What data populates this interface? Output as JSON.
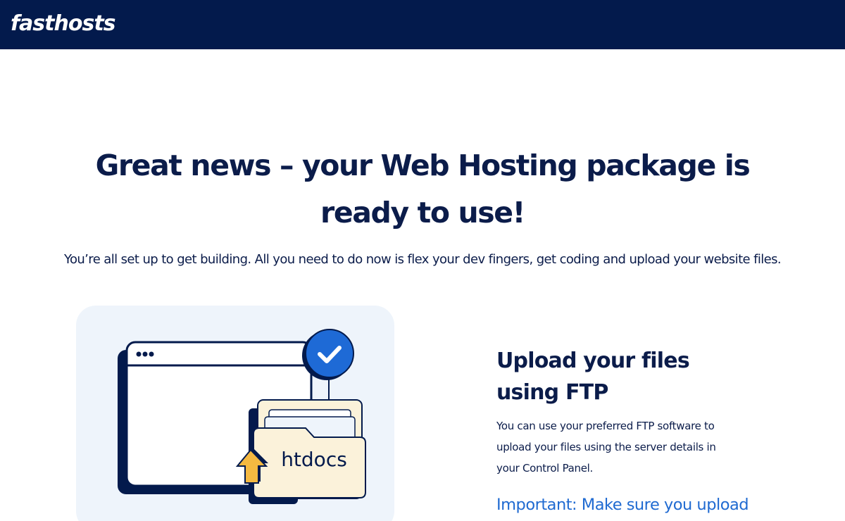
{
  "header": {
    "logo_text": "fasthosts",
    "background": "#031a4c"
  },
  "hero": {
    "title": "Great news – your Web Hosting package is ready to use!",
    "subtitle": "You’re all set up to get building. All you need to do now is flex your dev fingers, get coding and upload your website files."
  },
  "illustration": {
    "folder_label": "htdocs",
    "icons": [
      "browser-window-icon",
      "check-circle-icon",
      "folder-icon",
      "upload-arrow-icon"
    ],
    "colors": {
      "navy": "#031a4c",
      "blue": "#1e6ad6",
      "folder": "#fbf2da",
      "arrow": "#f5b941",
      "card": "#eef4fb"
    }
  },
  "ftp_section": {
    "title": "Upload your files using FTP",
    "text": "You can use your preferred FTP software to upload your files using the server details in your Control Panel.",
    "important": "Important: Make sure you upload"
  }
}
